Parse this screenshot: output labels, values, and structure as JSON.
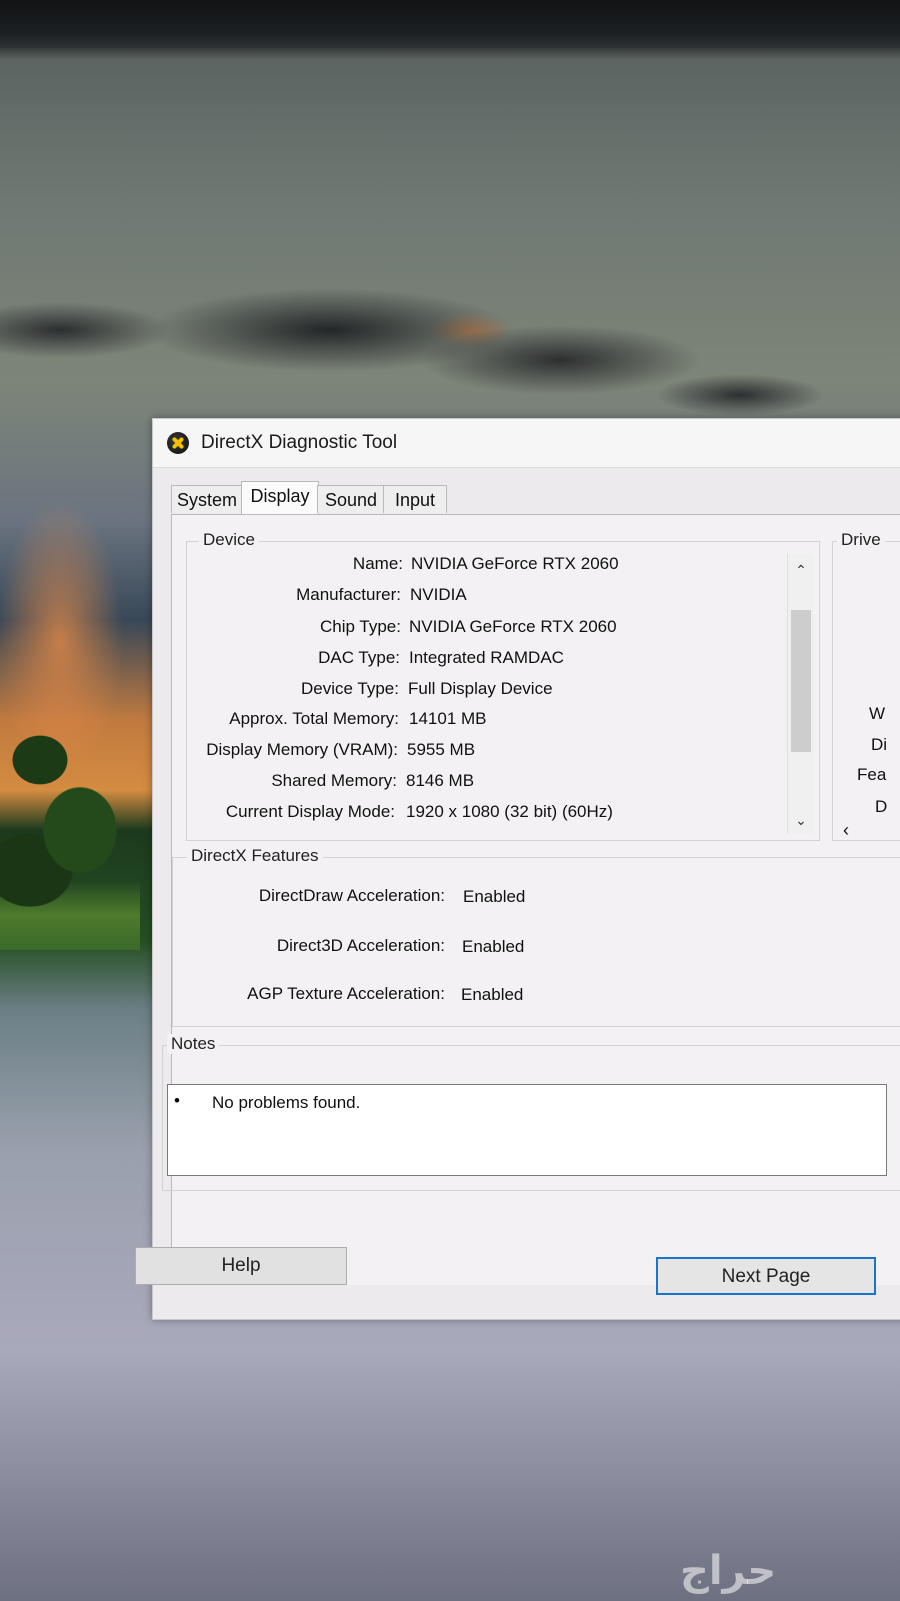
{
  "window": {
    "title": "DirectX Diagnostic Tool"
  },
  "tabs": [
    {
      "label": "System",
      "active": false
    },
    {
      "label": "Display",
      "active": true
    },
    {
      "label": "Sound",
      "active": false
    },
    {
      "label": "Input",
      "active": false
    }
  ],
  "device": {
    "group_title": "Device",
    "rows": [
      {
        "label": "Name:",
        "value": "NVIDIA GeForce RTX 2060"
      },
      {
        "label": "Manufacturer:",
        "value": "NVIDIA"
      },
      {
        "label": "Chip Type:",
        "value": "NVIDIA GeForce RTX 2060"
      },
      {
        "label": "DAC Type:",
        "value": "Integrated RAMDAC"
      },
      {
        "label": "Device Type:",
        "value": "Full Display Device"
      },
      {
        "label": "Approx. Total Memory:",
        "value": "14101 MB"
      },
      {
        "label": "Display Memory (VRAM):",
        "value": "5955 MB"
      },
      {
        "label": "Shared Memory:",
        "value": "8146 MB"
      },
      {
        "label": "Current Display Mode:",
        "value": "1920 x 1080 (32 bit) (60Hz)"
      }
    ]
  },
  "drivers": {
    "group_title_partial": "Drive",
    "partial_labels": [
      "W",
      "Di",
      "Fea",
      "D"
    ]
  },
  "directx_features": {
    "group_title": "DirectX Features",
    "rows": [
      {
        "label": "DirectDraw Acceleration:",
        "value": "Enabled"
      },
      {
        "label": "Direct3D Acceleration:",
        "value": "Enabled"
      },
      {
        "label": "AGP Texture Acceleration:",
        "value": "Enabled"
      }
    ]
  },
  "notes": {
    "group_title": "Notes",
    "items": [
      "No problems found."
    ]
  },
  "buttons": {
    "help": "Help",
    "next_page": "Next Page"
  },
  "watermark": "حراج",
  "colors": {
    "focus_border": "#1a75c9",
    "window_bg": "#eceaec"
  }
}
